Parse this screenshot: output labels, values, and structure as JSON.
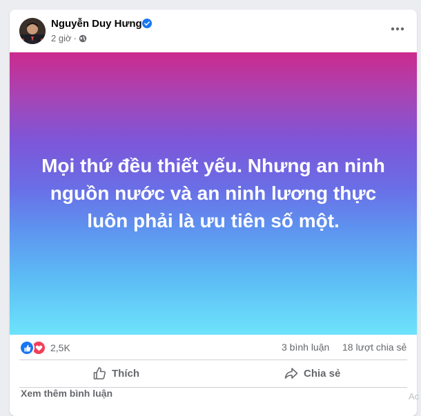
{
  "post": {
    "author": "Nguyễn Duy Hưng",
    "time": "2 giờ",
    "separator": "·",
    "body": "Mọi thứ đều thiết yếu. Nhưng an ninh nguồn nước và an ninh lương thực luôn phải là ưu tiên số một."
  },
  "icons": {
    "verified": "verified-badge-icon",
    "audience": "globe-icon",
    "more": "more-options-icon",
    "like_reaction": "like-reaction-icon",
    "love_reaction": "love-reaction-icon",
    "like_action": "thumbs-up-icon",
    "share_action": "share-arrow-icon"
  },
  "stats": {
    "reaction_count": "2,5K",
    "comments": "3 bình luận",
    "shares": "18 lượt chia sẻ"
  },
  "actions": {
    "like": "Thích",
    "share": "Chia sẻ"
  },
  "footer": {
    "see_more_comments": "Xem thêm bình luận",
    "corner": "Ac"
  },
  "colors": {
    "accent": "#1877f2",
    "love": "#f33e58",
    "muted_text": "#65676b",
    "banner_top": "#cc2a8e",
    "banner_bottom": "#6de3fb"
  }
}
